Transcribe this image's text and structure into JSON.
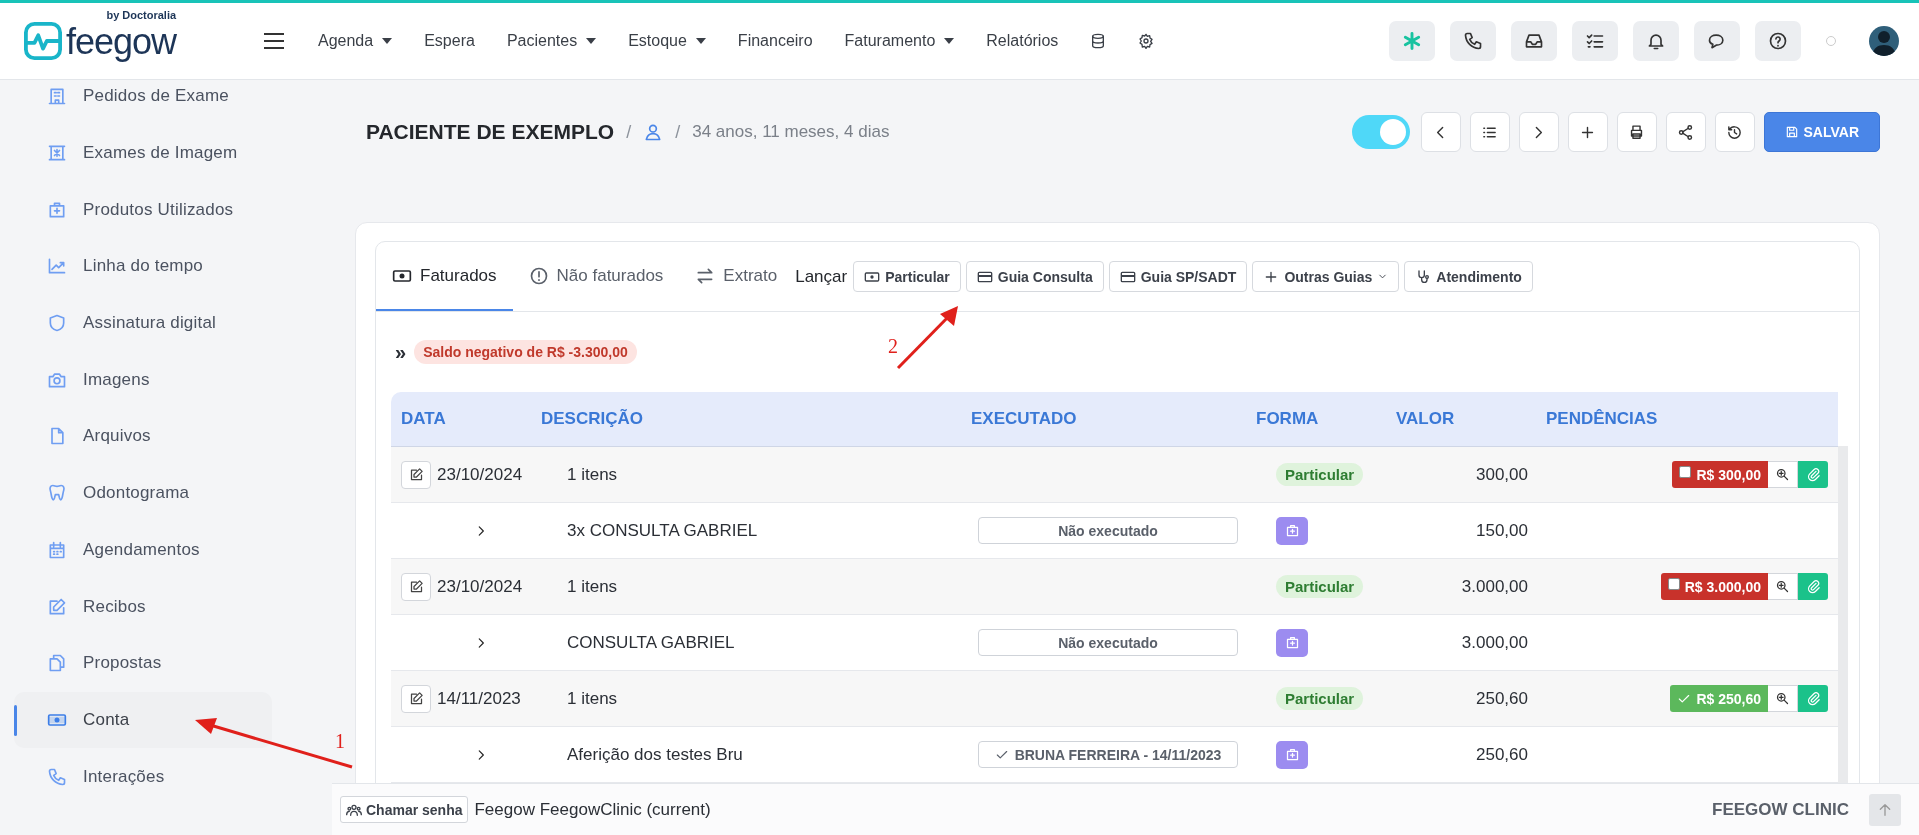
{
  "topbar": {
    "logo": "feegow",
    "tagline": "by Doctoralia",
    "nav": [
      {
        "label": "Agenda",
        "dropdown": true
      },
      {
        "label": "Espera",
        "dropdown": false
      },
      {
        "label": "Pacientes",
        "dropdown": true
      },
      {
        "label": "Estoque",
        "dropdown": true
      },
      {
        "label": "Financeiro",
        "dropdown": false
      },
      {
        "label": "Faturamento",
        "dropdown": true
      },
      {
        "label": "Relatórios",
        "dropdown": false
      }
    ]
  },
  "sidebar": {
    "items": [
      {
        "label": "Pedidos de Exame",
        "selected": false
      },
      {
        "label": "Exames de Imagem",
        "selected": false
      },
      {
        "label": "Produtos Utilizados",
        "selected": false
      },
      {
        "label": "Linha do tempo",
        "selected": false
      },
      {
        "label": "Assinatura digital",
        "selected": false
      },
      {
        "label": "Imagens",
        "selected": false
      },
      {
        "label": "Arquivos",
        "selected": false
      },
      {
        "label": "Odontograma",
        "selected": false
      },
      {
        "label": "Agendamentos",
        "selected": false
      },
      {
        "label": "Recibos",
        "selected": false
      },
      {
        "label": "Propostas",
        "selected": false
      },
      {
        "label": "Conta",
        "selected": true
      },
      {
        "label": "Interações",
        "selected": false
      }
    ]
  },
  "header": {
    "title": "PACIENTE DE EXEMPLO",
    "separators": [
      "/",
      "/"
    ],
    "age": "34 anos, 11 meses, 4 dias",
    "toggle_on": true,
    "save": "SALVAR"
  },
  "panel": {
    "tabs": [
      {
        "label": "Faturados",
        "selected": true
      },
      {
        "label": "Não faturados",
        "selected": false
      },
      {
        "label": "Extrato",
        "selected": false
      }
    ],
    "launch_label": "Lançar",
    "launch_buttons": [
      {
        "label": "Particular",
        "dropdown": false
      },
      {
        "label": "Guia Consulta",
        "dropdown": false
      },
      {
        "label": "Guia SP/SADT",
        "dropdown": false
      },
      {
        "label": "Outras Guias",
        "dropdown": true
      },
      {
        "label": "Atendimento",
        "dropdown": false
      }
    ],
    "expand": "»",
    "balance": "Saldo negativo de R$ -3.300,00"
  },
  "table": {
    "columns": [
      "DATA",
      "DESCRIÇÃO",
      "EXECUTADO",
      "FORMA",
      "VALOR",
      "PENDÊNCIAS"
    ],
    "rows": [
      {
        "kind": "invoice",
        "date": "23/10/2024",
        "description": "1 itens",
        "form": "Particular",
        "value": "300,00",
        "pending": {
          "amount": "R$ 300,00",
          "paid": false,
          "checked": false
        }
      },
      {
        "kind": "item",
        "description": "3x CONSULTA GABRIEL",
        "executed": {
          "text": "Não executado",
          "done": false
        },
        "value": "150,00"
      },
      {
        "kind": "invoice",
        "date": "23/10/2024",
        "description": "1 itens",
        "form": "Particular",
        "value": "3.000,00",
        "pending": {
          "amount": "R$ 3.000,00",
          "paid": false,
          "checked": false
        }
      },
      {
        "kind": "item",
        "description": "CONSULTA GABRIEL",
        "executed": {
          "text": "Não executado",
          "done": false
        },
        "value": "3.000,00"
      },
      {
        "kind": "invoice",
        "date": "14/11/2023",
        "description": "1 itens",
        "form": "Particular",
        "value": "250,60",
        "pending": {
          "amount": "R$ 250,60",
          "paid": true
        }
      },
      {
        "kind": "item",
        "description": "Aferição dos testes Bru",
        "executed": {
          "text": "BRUNA FERREIRA - 14/11/2023",
          "done": true
        },
        "value": "250,60"
      }
    ]
  },
  "footer": {
    "call_button": "Chamar senha",
    "environment": "Feegow FeegowClinic (current)",
    "clinic": "FEEGOW CLINIC"
  },
  "annotations": [
    {
      "label": "1"
    },
    {
      "label": "2"
    }
  ]
}
